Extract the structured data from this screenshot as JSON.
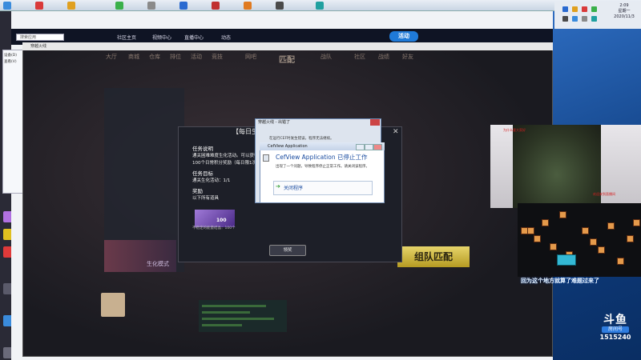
{
  "taskbar": {
    "icons": [
      {
        "name": "app1-icon",
        "color": "#3a8bdc"
      },
      {
        "name": "app2-icon",
        "color": "#d93a3a"
      },
      {
        "name": "app3-icon",
        "color": "#e0a020"
      },
      {
        "name": "app4-icon",
        "color": "#3ab04a"
      },
      {
        "name": "app5-icon",
        "color": "#8a8a8a"
      },
      {
        "name": "app6-icon",
        "color": "#2a6ad0"
      },
      {
        "name": "app7-icon",
        "color": "#c03030"
      },
      {
        "name": "app8-icon",
        "color": "#e07a20"
      },
      {
        "name": "app9-icon",
        "color": "#4a4a4a"
      },
      {
        "name": "app10-icon",
        "color": "#20a0a0"
      }
    ],
    "clock_time": "2:09",
    "clock_day": "星期一",
    "clock_date": "2020/11/3"
  },
  "browser": {
    "search_placeholder": "搜索应用",
    "nav": [
      "社区主页",
      "视频中心",
      "直播中心",
      "动态"
    ],
    "live_button": "活动"
  },
  "game": {
    "window_title": "穿越火线",
    "menu": [
      "大厅",
      "商城",
      "仓库",
      "排位",
      "活动",
      "竞技",
      "网吧",
      "",
      "战队",
      "社区",
      "战绩",
      "好友"
    ],
    "match_label": "匹配",
    "team_match": "组队匹配",
    "bio_button": "生化模式"
  },
  "task_dialog": {
    "title": "【每日生化】生化模式",
    "desc_heading": "任务说明",
    "desc_text": "通关困难难度生化活动。可以获得100个日常积分奖励（每日限1次）",
    "goal_heading": "任务目标",
    "goal_text": "通关生化活动：1/1",
    "reward_heading": "奖励",
    "reward_text": "以下所有道具",
    "reward_count": "100",
    "reward_label": "不稳定的能量结晶：100个",
    "receive_button": "领奖"
  },
  "error_dialog": {
    "outer_title": "穿越火线 - 出错了",
    "outer_warn": "在运行CEF时发生错误，程序无法继续。",
    "inner_title": "CefView Application",
    "heading": "CefView Application 已停止工作",
    "message": "出现了一个问题，导致程序停止正常工作。请关闭该程序。",
    "close_button": "关闭程序"
  },
  "webcam": {
    "banner": "为什么要大家好",
    "red_text": "欢迎来到直播间"
  },
  "danmu": "回为这个地方就算了难题过来了",
  "douyu": {
    "logo": "斗鱼",
    "room_label": "房间号",
    "room_number": "1515240"
  },
  "left_popup": {
    "lines": [
      "设备(D)",
      "",
      "查看(V)",
      ""
    ]
  }
}
